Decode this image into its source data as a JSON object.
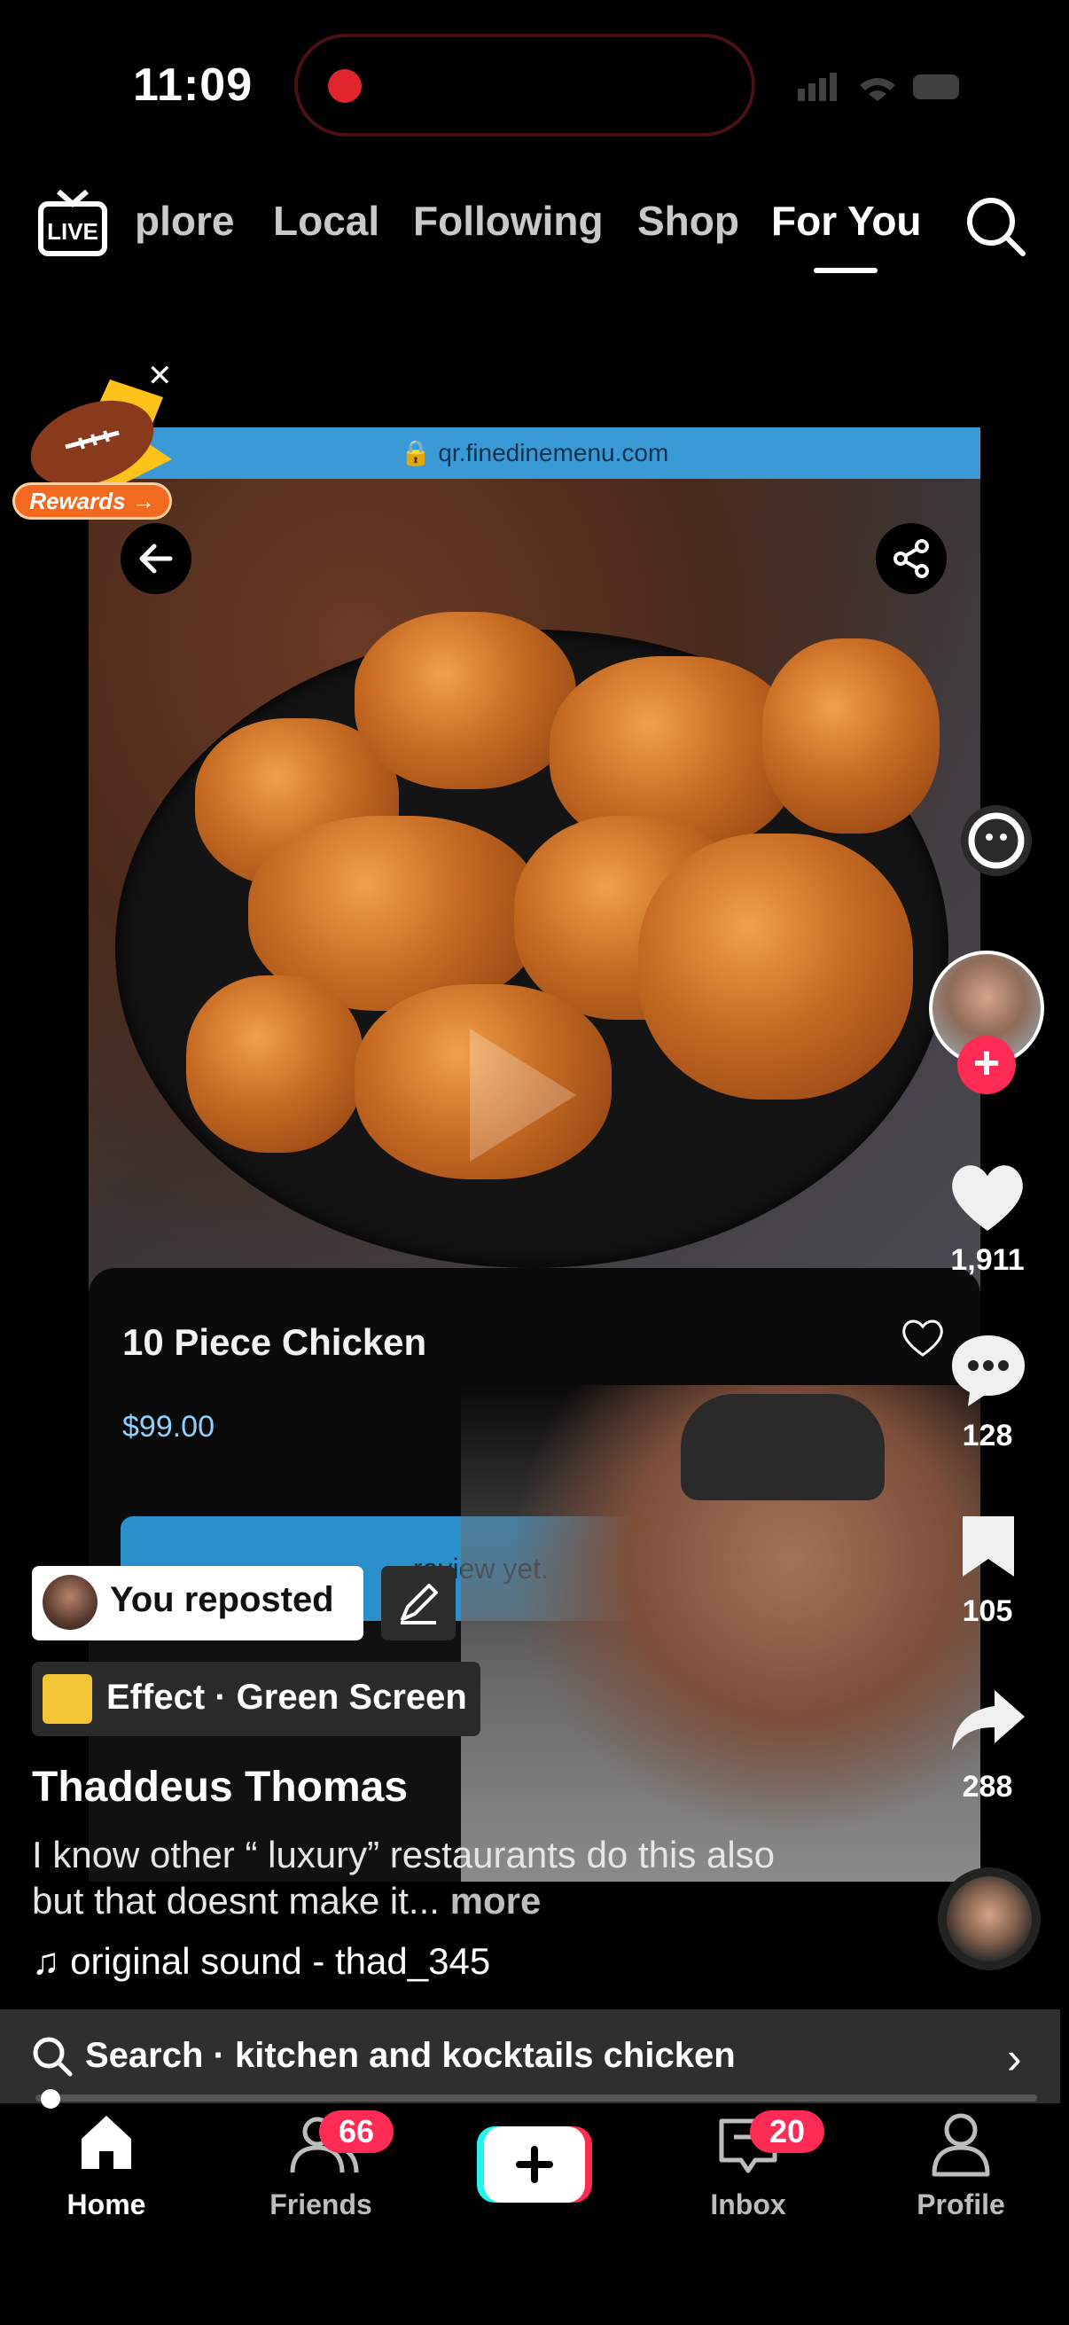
{
  "status": {
    "time": "11:09"
  },
  "top_nav": {
    "live_label": "LIVE",
    "tabs": [
      {
        "label": "plore"
      },
      {
        "label": "Local"
      },
      {
        "label": "Following"
      },
      {
        "label": "Shop"
      },
      {
        "label": "For You",
        "active": true
      }
    ]
  },
  "rewards": {
    "label": "Rewards →"
  },
  "video": {
    "url": "qr.finedinemenu.com",
    "item_title": "10 Piece Chicken",
    "item_price": "$99.00",
    "review_left": "review yet.",
    "review_right": "view"
  },
  "rail": {
    "likes": "1,911",
    "comments": "128",
    "saves": "105",
    "shares": "288"
  },
  "post": {
    "reposted": "You reposted",
    "effect": "Effect · Green Screen",
    "author": "Thaddeus Thomas",
    "description": "I know other “ luxury” restaurants do this also but that doesnt make it...",
    "more": "more",
    "sound": "original sound - thad_345"
  },
  "search_bar": {
    "text": "Search · kitchen and kocktails chicken"
  },
  "bottom_nav": {
    "home": "Home",
    "friends": "Friends",
    "friends_badge": "66",
    "inbox": "Inbox",
    "inbox_badge": "20",
    "profile": "Profile"
  },
  "colors": {
    "accent": "#fe2c55",
    "url_bar": "#3a9ad6",
    "price": "#8fd0ff"
  }
}
